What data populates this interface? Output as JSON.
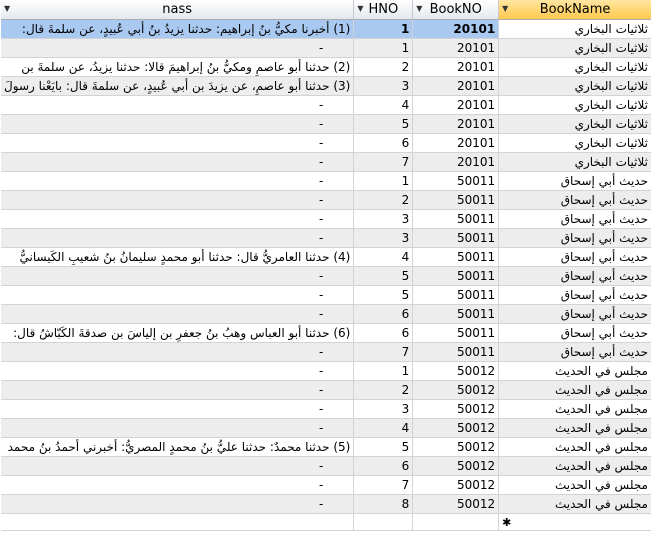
{
  "columns": {
    "book_name": "BookName",
    "book_no": "BookNO",
    "hno": "HNO",
    "nass": "nass"
  },
  "new_row_marker": "✱",
  "rows": [
    {
      "book": "ثلاثيات البخاري",
      "bno": "20101",
      "hno": "1",
      "nass": "(1) أخبرنا مكيُّ بنُ إبراهيم: حدثنا يزيدُ بنُ أبي عُبيدٍ، عن سلمةَ قال:"
    },
    {
      "book": "ثلاثيات البخاري",
      "bno": "20101",
      "hno": "1",
      "nass": "-"
    },
    {
      "book": "ثلاثيات البخاري",
      "bno": "20101",
      "hno": "2",
      "nass": "(2) حدثنا أبو عاصمٍ ومكيُّ بنُ إبراهيمَ قالا: حدثنا يزيدُ، عن سلمةَ بن"
    },
    {
      "book": "ثلاثيات البخاري",
      "bno": "20101",
      "hno": "3",
      "nass": "(3) حدثنا أبو عاصمٍ، عن يزيدَ بن أبي عُبيدٍ، عن سلمةَ قال: بايَعْنا رسولَ"
    },
    {
      "book": "ثلاثيات البخاري",
      "bno": "20101",
      "hno": "4",
      "nass": "-"
    },
    {
      "book": "ثلاثيات البخاري",
      "bno": "20101",
      "hno": "5",
      "nass": "-"
    },
    {
      "book": "ثلاثيات البخاري",
      "bno": "20101",
      "hno": "6",
      "nass": "-"
    },
    {
      "book": "ثلاثيات البخاري",
      "bno": "20101",
      "hno": "7",
      "nass": "-"
    },
    {
      "book": "حديث أبي إسحاق",
      "bno": "50011",
      "hno": "1",
      "nass": "-"
    },
    {
      "book": "حديث أبي إسحاق",
      "bno": "50011",
      "hno": "2",
      "nass": "-"
    },
    {
      "book": "حديث أبي إسحاق",
      "bno": "50011",
      "hno": "3",
      "nass": "-"
    },
    {
      "book": "حديث أبي إسحاق",
      "bno": "50011",
      "hno": "3",
      "nass": "-"
    },
    {
      "book": "حديث أبي إسحاق",
      "bno": "50011",
      "hno": "4",
      "nass": "(4) حدثنا العامريُّ قال: حدثنا أبو محمدٍ سليمانُ بنُ شعيبِ الكَيسانيُّ"
    },
    {
      "book": "حديث أبي إسحاق",
      "bno": "50011",
      "hno": "5",
      "nass": "-"
    },
    {
      "book": "حديث أبي إسحاق",
      "bno": "50011",
      "hno": "5",
      "nass": "-"
    },
    {
      "book": "حديث أبي إسحاق",
      "bno": "50011",
      "hno": "6",
      "nass": "-"
    },
    {
      "book": "حديث أبي إسحاق",
      "bno": "50011",
      "hno": "6",
      "nass": "(6) حدثنا أبو العباس وهبُ بنُ جعفرِ بن إلياسَ بن صدقةَ الكَبّاشُ قال:"
    },
    {
      "book": "حديث أبي إسحاق",
      "bno": "50011",
      "hno": "7",
      "nass": "-"
    },
    {
      "book": "مجلس في الحديث",
      "bno": "50012",
      "hno": "1",
      "nass": "-"
    },
    {
      "book": "مجلس في الحديث",
      "bno": "50012",
      "hno": "2",
      "nass": "-"
    },
    {
      "book": "مجلس في الحديث",
      "bno": "50012",
      "hno": "3",
      "nass": "-"
    },
    {
      "book": "مجلس في الحديث",
      "bno": "50012",
      "hno": "4",
      "nass": "-"
    },
    {
      "book": "مجلس في الحديث",
      "bno": "50012",
      "hno": "5",
      "nass": "(5) حدثنا محمدٌ: حدثنا عليُّ بنُ محمدٍ المصريُّ: أخبرني أحمدُ بنُ محمد"
    },
    {
      "book": "مجلس في الحديث",
      "bno": "50012",
      "hno": "6",
      "nass": "-"
    },
    {
      "book": "مجلس في الحديث",
      "bno": "50012",
      "hno": "7",
      "nass": "-"
    },
    {
      "book": "مجلس في الحديث",
      "bno": "50012",
      "hno": "8",
      "nass": "-"
    }
  ]
}
